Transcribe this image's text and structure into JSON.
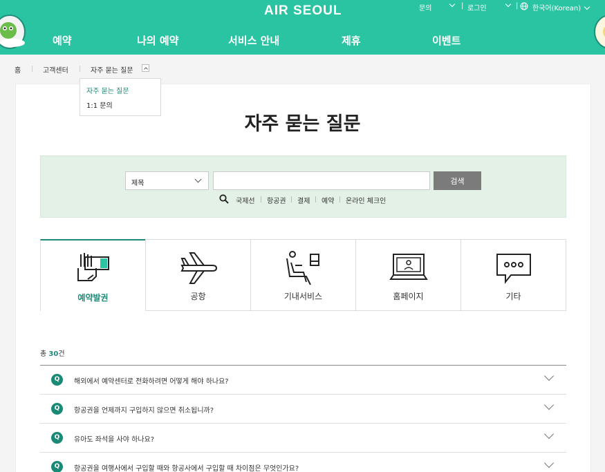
{
  "header": {
    "logo": "AIR SEOUL",
    "util": {
      "inquiry": "문의",
      "login": "로그인",
      "language": "한국어(Korean)"
    },
    "nav": [
      "예약",
      "나의 예약",
      "서비스 안내",
      "제휴",
      "이벤트"
    ]
  },
  "breadcrumb": [
    "홈",
    "고객센터",
    "자주 묻는 질문"
  ],
  "breadcrumb_menu": [
    "자주 묻는 질문",
    "1:1 문의"
  ],
  "page_title": "자주 묻는 질문",
  "search": {
    "select_value": "제목",
    "input_value": "",
    "button": "검색",
    "keywords": [
      "국제선",
      "항공권",
      "결제",
      "예약",
      "온라인 체크인"
    ]
  },
  "categories": [
    {
      "label": "예약발권",
      "icon": "ticket-hand-icon",
      "active": true
    },
    {
      "label": "공항",
      "icon": "airplane-icon",
      "active": false
    },
    {
      "label": "기내서비스",
      "icon": "seat-icon",
      "active": false
    },
    {
      "label": "홈페이지",
      "icon": "laptop-icon",
      "active": false
    },
    {
      "label": "기타",
      "icon": "chat-bubble-icon",
      "active": false
    }
  ],
  "count": {
    "prefix": "총",
    "number": "30",
    "suffix": "건"
  },
  "faq": [
    {
      "badge": "Q",
      "question": "해외에서 예약센터로 전화하려면 어떻게 해야 하나요?"
    },
    {
      "badge": "Q",
      "question": "항공권을 언제까지 구입하지 않으면 취소됩니까?"
    },
    {
      "badge": "Q",
      "question": "유아도 좌석을 사야 하나요?"
    },
    {
      "badge": "Q",
      "question": "항공권을 여행사에서 구입할 때와 항공사에서 구입할 때 차이점은 무엇인가요?"
    }
  ],
  "colors": {
    "brand": "#2bc4a3",
    "accent": "#1a8a76",
    "search_bg": "#e3f1e6",
    "button": "#7b7b7b"
  }
}
